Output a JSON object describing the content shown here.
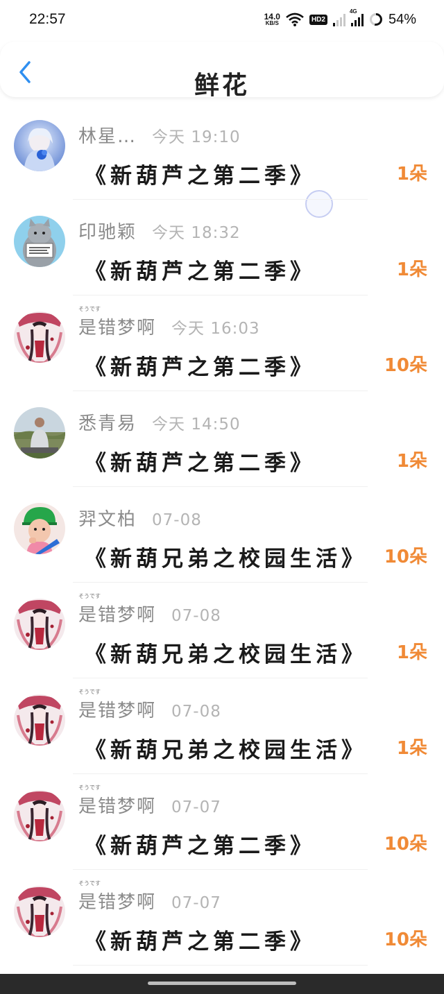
{
  "status_bar": {
    "time": "22:57",
    "net_speed": "14.0",
    "net_unit": "KB/S",
    "hd_label": "HD2",
    "network_label": "4G",
    "battery": "54%"
  },
  "header": {
    "title": "鲜花",
    "back_icon": "chevron-left-icon"
  },
  "colors": {
    "accent_orange": "#f08a36",
    "back_blue": "#2f8ff0",
    "name_gray": "#8a8a8a",
    "time_gray": "#b4b4b4"
  },
  "records": [
    {
      "name": "林星…",
      "kana": "",
      "time": "今天 19:10",
      "title": "《新葫芦之第二季》",
      "count": "1朵",
      "avatar": "blue-flower-girl"
    },
    {
      "name": "印驰颖",
      "kana": "",
      "time": "今天 18:32",
      "title": "《新葫芦之第二季》",
      "count": "1朵",
      "avatar": "cat-with-sign"
    },
    {
      "name": "是错梦啊",
      "kana": "そうです",
      "time": "今天 16:03",
      "title": "《新葫芦之第二季》",
      "count": "10朵",
      "avatar": "anime-girl-red"
    },
    {
      "name": "悉青易",
      "kana": "",
      "time": "今天 14:50",
      "title": "《新葫芦之第二季》",
      "count": "1朵",
      "avatar": "man-landscape"
    },
    {
      "name": "羿文柏",
      "kana": "",
      "time": "07-08",
      "title": "《新葫兄弟之校园生活》",
      "count": "10朵",
      "avatar": "boy-green-cap"
    },
    {
      "name": "是错梦啊",
      "kana": "そうです",
      "time": "07-08",
      "title": "《新葫兄弟之校园生活》",
      "count": "1朵",
      "avatar": "anime-girl-red"
    },
    {
      "name": "是错梦啊",
      "kana": "そうです",
      "time": "07-08",
      "title": "《新葫兄弟之校园生活》",
      "count": "1朵",
      "avatar": "anime-girl-red"
    },
    {
      "name": "是错梦啊",
      "kana": "そうです",
      "time": "07-07",
      "title": "《新葫芦之第二季》",
      "count": "10朵",
      "avatar": "anime-girl-red"
    },
    {
      "name": "是错梦啊",
      "kana": "そうです",
      "time": "07-07",
      "title": "《新葫芦之第二季》",
      "count": "10朵",
      "avatar": "anime-girl-red"
    }
  ]
}
